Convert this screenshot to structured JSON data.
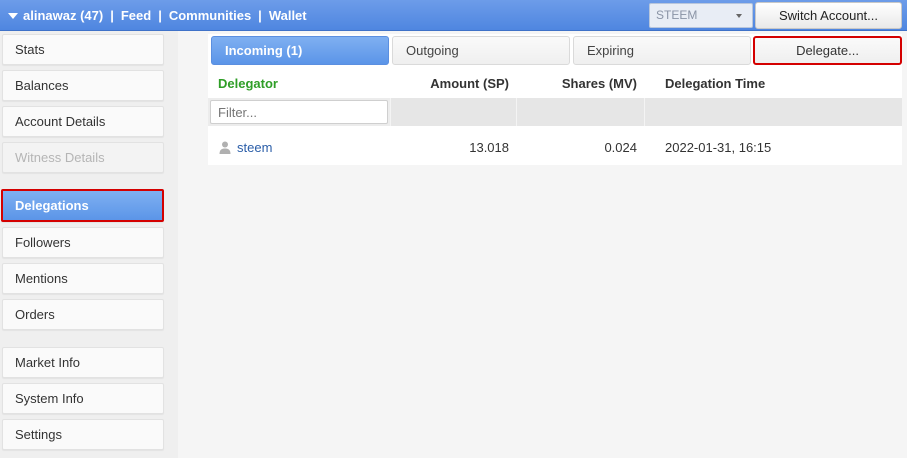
{
  "topbar": {
    "account": "alinawaz (47)",
    "links": [
      "Feed",
      "Communities",
      "Wallet"
    ],
    "separator": "|",
    "chain_selected": "STEEM",
    "switch_account_label": "Switch Account..."
  },
  "sidebar": {
    "items": [
      {
        "label": "Stats",
        "state": "normal"
      },
      {
        "label": "Balances",
        "state": "normal"
      },
      {
        "label": "Account Details",
        "state": "normal"
      },
      {
        "label": "Witness Details",
        "state": "disabled"
      },
      {
        "label": "Delegations",
        "state": "active"
      },
      {
        "label": "Followers",
        "state": "normal"
      },
      {
        "label": "Mentions",
        "state": "normal"
      },
      {
        "label": "Orders",
        "state": "normal"
      },
      {
        "label": "Market Info",
        "state": "normal"
      },
      {
        "label": "System Info",
        "state": "normal"
      },
      {
        "label": "Settings",
        "state": "normal"
      }
    ]
  },
  "tabs": {
    "incoming": "Incoming (1)",
    "outgoing": "Outgoing",
    "expiring": "Expiring",
    "delegate": "Delegate..."
  },
  "table": {
    "headers": {
      "delegator": "Delegator",
      "amount": "Amount (SP)",
      "shares": "Shares (MV)",
      "time": "Delegation Time"
    },
    "filter_placeholder": "Filter...",
    "rows": [
      {
        "delegator": "steem",
        "amount": "13.018",
        "shares": "0.024",
        "time": "2022-01-31, 16:15"
      }
    ]
  },
  "colors": {
    "accent": "#5b95e8",
    "highlight": "#d40000",
    "delegator_header": "#2f9e27",
    "link": "#2b5ea8"
  }
}
